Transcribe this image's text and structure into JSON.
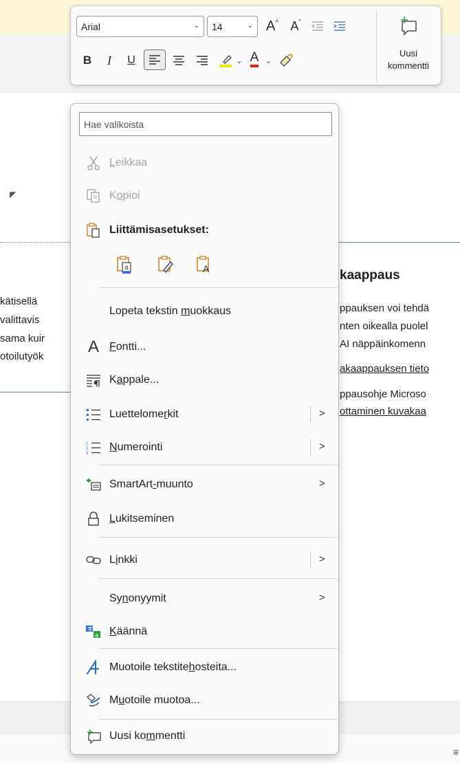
{
  "document": {
    "heading": "kaappaus",
    "left_lines": [
      "kätisellä",
      "valittavis",
      "sama kuir",
      "otoilutyök"
    ],
    "right_lines": [
      "ppauksen voi tehdä",
      "nten oikealla puolel",
      "AI näppäinkomenn"
    ],
    "right_link1": "akaappauksen tieto",
    "right_line5": "ppausohje Microso",
    "right_link2": "ottaminen kuvakaa"
  },
  "toolbar": {
    "font": "Arial",
    "size": "14",
    "grow_font_label": "A",
    "shrink_font_label": "A",
    "bold_label": "B",
    "italic_label": "I",
    "underline_label": "U",
    "font_color_label": "A",
    "new_comment_line1": "Uusi",
    "new_comment_line2": "kommentti",
    "highlight_color": "#f2e600",
    "font_color": "#e0201b"
  },
  "menu": {
    "search_placeholder": "Hae valikoista",
    "cut": {
      "text": "Leikkaa",
      "mnemonic": "L",
      "rest": "eikkaa"
    },
    "copy": {
      "pre": "K",
      "mnemonic": "o",
      "rest": "pioi"
    },
    "paste_options": "Liittämisasetukset:",
    "stop_editing": {
      "pre": "Lopeta tekstin ",
      "mnemonic": "m",
      "rest": "uokkaus"
    },
    "font": {
      "mnemonic": "F",
      "rest": "ontti..."
    },
    "paragraph": {
      "pre": "K",
      "mnemonic": "a",
      "rest": "ppale..."
    },
    "bullets": {
      "pre": "Luettelome",
      "mnemonic": "r",
      "rest": "kit"
    },
    "numbering": {
      "mnemonic": "N",
      "rest": "umerointi"
    },
    "smartart": {
      "pre": "SmartArt",
      "mnemonic": "-",
      "rest": "muunto"
    },
    "lock": {
      "mnemonic": "L",
      "rest": "ukitseminen"
    },
    "link": {
      "pre": "L",
      "mnemonic": "i",
      "rest": "nkki"
    },
    "synonyms": {
      "pre": "Sy",
      "mnemonic": "n",
      "rest": "onyymit"
    },
    "translate": {
      "mnemonic": "K",
      "rest": "äännä"
    },
    "text_effects": {
      "pre": "Muotoile tekstite",
      "mnemonic": "h",
      "rest": "osteita..."
    },
    "format_shape": {
      "pre": "M",
      "mnemonic": "u",
      "rest": "otoile muotoa..."
    },
    "new_comment": {
      "pre": "Uusi ko",
      "mnemonic": "m",
      "rest": "mentti"
    }
  },
  "icons": {
    "cut": "scissors-icon",
    "copy": "copy-icon",
    "paste": "clipboard-icon",
    "font": "font-a-icon",
    "paragraph": "paragraph-icon",
    "bullets": "bullets-icon",
    "numbering": "numbering-icon",
    "smartart": "smartart-icon",
    "lock": "lock-icon",
    "link": "link-icon",
    "translate": "translate-icon",
    "text_effects": "text-effects-icon",
    "format_shape": "format-shape-icon",
    "new_comment": "new-comment-icon"
  },
  "colors": {
    "accent_green": "#2f9e44",
    "accent_blue": "#1e6fc2",
    "accent_orange": "#c47a17"
  }
}
